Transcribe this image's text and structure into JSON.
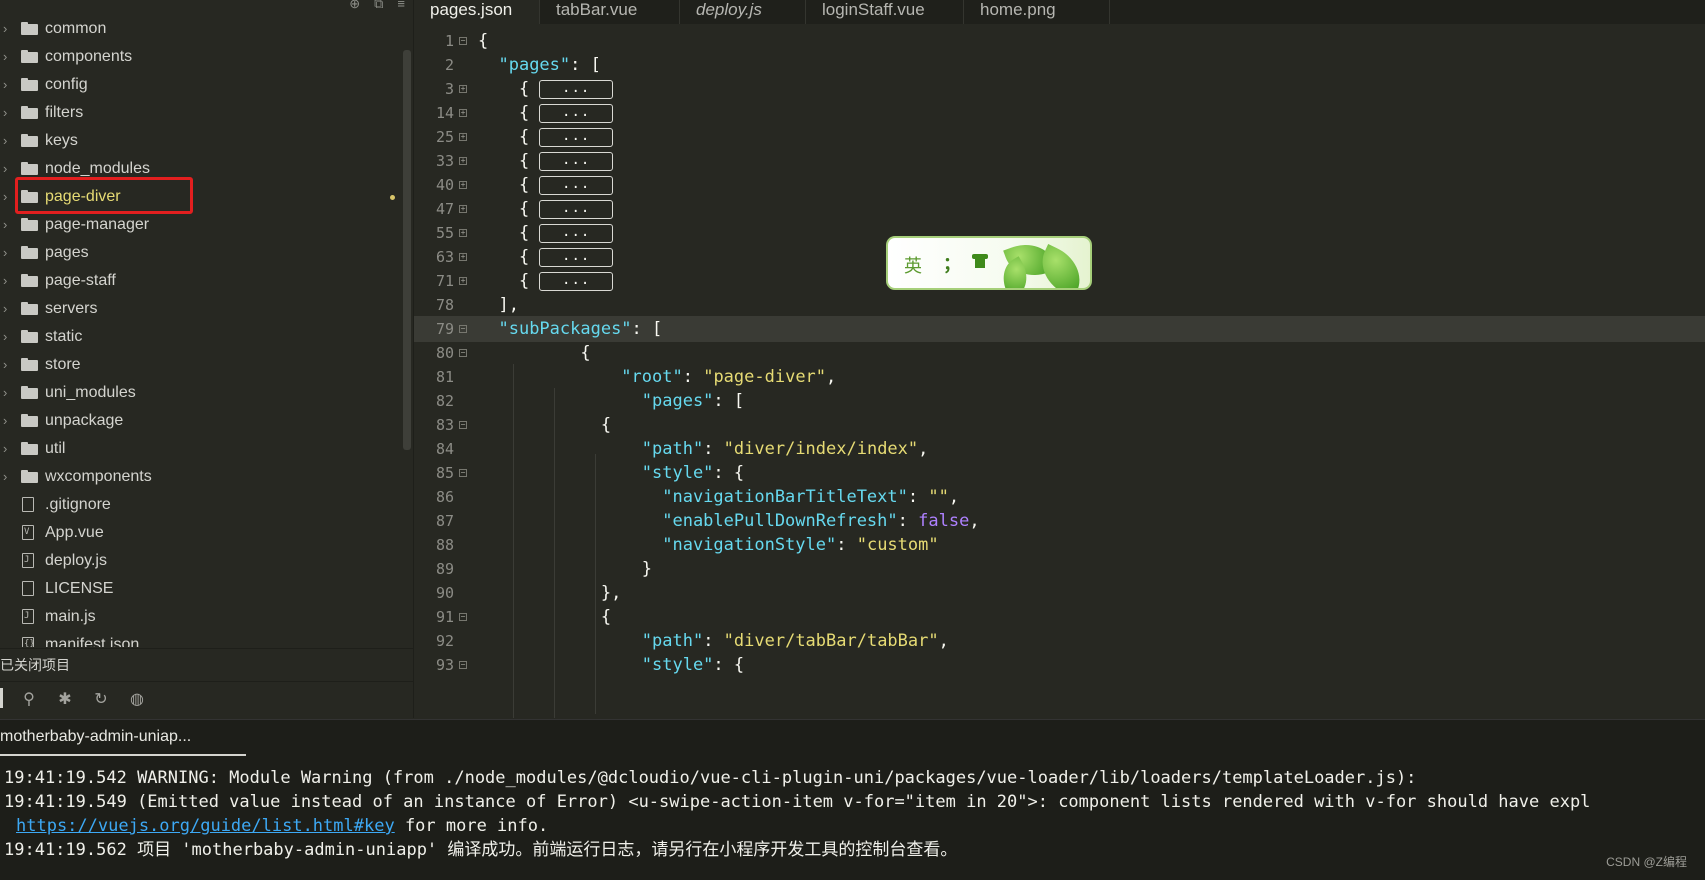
{
  "sidebar": {
    "items": [
      {
        "label": "common",
        "type": "folder"
      },
      {
        "label": "components",
        "type": "folder"
      },
      {
        "label": "config",
        "type": "folder"
      },
      {
        "label": "filters",
        "type": "folder"
      },
      {
        "label": "keys",
        "type": "folder"
      },
      {
        "label": "node_modules",
        "type": "folder"
      },
      {
        "label": "page-diver",
        "type": "folder",
        "selected": true,
        "modified": true
      },
      {
        "label": "page-manager",
        "type": "folder"
      },
      {
        "label": "pages",
        "type": "folder"
      },
      {
        "label": "page-staff",
        "type": "folder"
      },
      {
        "label": "servers",
        "type": "folder"
      },
      {
        "label": "static",
        "type": "folder"
      },
      {
        "label": "store",
        "type": "folder"
      },
      {
        "label": "uni_modules",
        "type": "folder"
      },
      {
        "label": "unpackage",
        "type": "folder"
      },
      {
        "label": "util",
        "type": "folder"
      },
      {
        "label": "wxcomponents",
        "type": "folder"
      },
      {
        "label": ".gitignore",
        "type": "file",
        "glyph": ""
      },
      {
        "label": "App.vue",
        "type": "file",
        "glyph": "V"
      },
      {
        "label": "deploy.js",
        "type": "file",
        "glyph": "J"
      },
      {
        "label": "LICENSE",
        "type": "file",
        "glyph": ""
      },
      {
        "label": "main.js",
        "type": "file",
        "glyph": "J"
      },
      {
        "label": "manifest.json",
        "type": "file",
        "glyph": "{}"
      }
    ],
    "closed_projects_label": "已关闭项目",
    "top_icons": [
      "⊕",
      "⧉",
      "≡"
    ],
    "toolbar_icons": [
      "binoculars-icon",
      "bug-icon",
      "refresh-icon",
      "globe-icon"
    ]
  },
  "tabs": [
    {
      "label": "pages.json",
      "active": true,
      "italic": false
    },
    {
      "label": "tabBar.vue",
      "active": false,
      "italic": false
    },
    {
      "label": "deploy.js",
      "active": false,
      "italic": true
    },
    {
      "label": "loginStaff.vue",
      "active": false,
      "italic": false
    },
    {
      "label": "home.png",
      "active": false,
      "italic": false
    }
  ],
  "editor": {
    "lines": [
      {
        "n": "1",
        "fold": "-",
        "html": "<span class=\"p\">{</span>"
      },
      {
        "n": "2",
        "fold": "",
        "html": "  <span class=\"k\">\"pages\"</span><span class=\"p\">: [</span>"
      },
      {
        "n": "3",
        "fold": "+",
        "html": "    <span class=\"p\">{</span>",
        "collapsed": true
      },
      {
        "n": "14",
        "fold": "+",
        "html": "    <span class=\"p\">{</span>",
        "collapsed": true
      },
      {
        "n": "25",
        "fold": "+",
        "html": "    <span class=\"p\">{</span>",
        "collapsed": true
      },
      {
        "n": "33",
        "fold": "+",
        "html": "    <span class=\"p\">{</span>",
        "collapsed": true
      },
      {
        "n": "40",
        "fold": "+",
        "html": "    <span class=\"p\">{</span>",
        "collapsed": true
      },
      {
        "n": "47",
        "fold": "+",
        "html": "    <span class=\"p\">{</span>",
        "collapsed": true
      },
      {
        "n": "55",
        "fold": "+",
        "html": "    <span class=\"p\">{</span>",
        "collapsed": true
      },
      {
        "n": "63",
        "fold": "+",
        "html": "    <span class=\"p\">{</span>",
        "collapsed": true
      },
      {
        "n": "71",
        "fold": "+",
        "html": "    <span class=\"p\">{</span>",
        "collapsed": true
      },
      {
        "n": "78",
        "fold": "",
        "html": "  <span class=\"p\">],</span>"
      },
      {
        "n": "79",
        "fold": "-",
        "html": "  <span class=\"k\">\"subPackages\"</span><span class=\"p\">: [</span>",
        "current": true
      },
      {
        "n": "80",
        "fold": "-",
        "html": "          <span class=\"p\">{</span>"
      },
      {
        "n": "81",
        "fold": "",
        "html": "              <span class=\"k\">\"root\"</span><span class=\"p\">: </span><span class=\"s\">\"page-diver\"</span><span class=\"p\">,</span>"
      },
      {
        "n": "82",
        "fold": "",
        "html": "                <span class=\"k\">\"pages\"</span><span class=\"p\">: [</span>"
      },
      {
        "n": "83",
        "fold": "-",
        "html": "            <span class=\"p\">{</span>"
      },
      {
        "n": "84",
        "fold": "",
        "html": "                <span class=\"k\">\"path\"</span><span class=\"p\">: </span><span class=\"s\">\"diver/index/index\"</span><span class=\"p\">,</span>"
      },
      {
        "n": "85",
        "fold": "-",
        "html": "                <span class=\"k\">\"style\"</span><span class=\"p\">: {</span>"
      },
      {
        "n": "86",
        "fold": "",
        "html": "                  <span class=\"k\">\"navigationBarTitleText\"</span><span class=\"p\">: </span><span class=\"s\">\"\"</span><span class=\"p\">,</span>"
      },
      {
        "n": "87",
        "fold": "",
        "html": "                  <span class=\"k\">\"enablePullDownRefresh\"</span><span class=\"p\">: </span><span class=\"b\">false</span><span class=\"p\">,</span>"
      },
      {
        "n": "88",
        "fold": "",
        "html": "                  <span class=\"k\">\"navigationStyle\"</span><span class=\"p\">: </span><span class=\"s\">\"custom\"</span>"
      },
      {
        "n": "89",
        "fold": "",
        "html": "                <span class=\"p\">}</span>"
      },
      {
        "n": "90",
        "fold": "",
        "html": "            <span class=\"p\">},</span>"
      },
      {
        "n": "91",
        "fold": "-",
        "html": "            <span class=\"p\">{</span>"
      },
      {
        "n": "92",
        "fold": "",
        "html": "                <span class=\"k\">\"path\"</span><span class=\"p\">: </span><span class=\"s\">\"diver/tabBar/tabBar\"</span><span class=\"p\">,</span>"
      },
      {
        "n": "93",
        "fold": "-",
        "html": "                <span class=\"k\">\"style\"</span><span class=\"p\">: {</span>"
      }
    ],
    "collapsed_label": "..."
  },
  "ime": {
    "lang": "英",
    "punct": "；",
    "skin_icon": "shirt-icon"
  },
  "console": {
    "tab_label": "motherbaby-admin-uniap...",
    "logs": [
      {
        "time": "19:41:19.542",
        "text": " WARNING: Module Warning (from ./node_modules/@dcloudio/vue-cli-plugin-uni/packages/vue-loader/lib/loaders/templateLoader.js):"
      },
      {
        "time": "19:41:19.549",
        "text": " (Emitted value instead of an instance of Error) <u-swipe-action-item v-for=\"item in 20\">: component lists rendered with v-for should have expl"
      },
      {
        "time": "",
        "link": "https://vuejs.org/guide/list.html#key",
        "text": " for more info."
      },
      {
        "time": "19:41:19.562",
        "text": " 项目 'motherbaby-admin-uniapp' 编译成功。前端运行日志，请另行在小程序开发工具的控制台查看。"
      }
    ]
  },
  "watermark": "CSDN @Z编程"
}
